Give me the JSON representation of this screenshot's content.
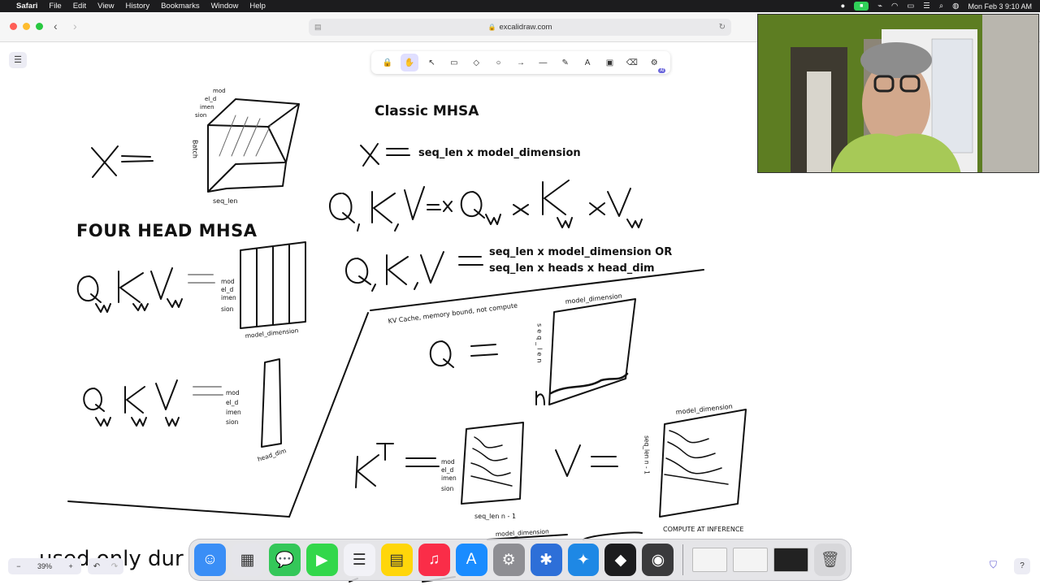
{
  "menubar": {
    "app": "Safari",
    "items": [
      "File",
      "Edit",
      "View",
      "History",
      "Bookmarks",
      "Window",
      "Help"
    ],
    "clock": "Mon Feb 3  9:10 AM"
  },
  "browser": {
    "url": "excalidraw.com"
  },
  "toolbar": {
    "tools": [
      {
        "icon": "lock-icon",
        "glyph": "🔒"
      },
      {
        "icon": "hand-icon",
        "glyph": "✋"
      },
      {
        "icon": "selection-icon",
        "glyph": "↖"
      },
      {
        "icon": "rectangle-icon",
        "glyph": "▭"
      },
      {
        "icon": "diamond-icon",
        "glyph": "◇"
      },
      {
        "icon": "ellipse-icon",
        "glyph": "○"
      },
      {
        "icon": "arrow-icon",
        "glyph": "→"
      },
      {
        "icon": "line-icon",
        "glyph": "—"
      },
      {
        "icon": "pencil-icon",
        "glyph": "✎"
      },
      {
        "icon": "text-icon",
        "glyph": "A"
      },
      {
        "icon": "image-icon",
        "glyph": "▣"
      },
      {
        "icon": "eraser-icon",
        "glyph": "⌫"
      },
      {
        "icon": "ai-tools-icon",
        "glyph": "⚙"
      }
    ],
    "active_index": 1,
    "ai_badge": "AI"
  },
  "drawing": {
    "title_classic": "Classic MHSA",
    "classic_x_shape": "seq_len x model_dimension",
    "qkv_shape_line1": "seq_len x model_dimension OR",
    "qkv_shape_line2": "seq_len x heads x head_dim",
    "title_four_head": "FOUR HEAD MHSA",
    "cube_side_label": "Batch",
    "cube_top_label": [
      "mod",
      "el_d",
      "imen",
      "sion"
    ],
    "cube_bottom_label": "seq_len",
    "model_dim_stack": [
      "mod",
      "el_d",
      "imen",
      "sion"
    ],
    "model_dimension_label": "model_dimension",
    "head_dim_label": "head_dim",
    "kv_cache_note": "KV Cache, memory bound, not compute",
    "seq_len_vertical": "seq_len",
    "seq_len_n1": "seq_len n - 1",
    "compute_note": "COMPUTE AT INFERENCE",
    "bottom_text": "used only dur",
    "q_cache_label": "Q",
    "k_label": "K",
    "v_label": "V",
    "n_label": "n"
  },
  "bottom_controls": {
    "zoom_out": "−",
    "zoom_level": "39%",
    "zoom_in": "+",
    "undo": "↶",
    "redo": "↷",
    "help": "?"
  },
  "dock": {
    "apps": [
      {
        "name": "finder",
        "glyph": "☺",
        "color": "#3a8ef6"
      },
      {
        "name": "launchpad",
        "glyph": "▦",
        "color": "#e5e5ea"
      },
      {
        "name": "messages",
        "glyph": "💬",
        "color": "#34c759"
      },
      {
        "name": "facetime",
        "glyph": "▶",
        "color": "#32d74b"
      },
      {
        "name": "reminders",
        "glyph": "☰",
        "color": "#f2f2f7"
      },
      {
        "name": "notes",
        "glyph": "▤",
        "color": "#ffd60a"
      },
      {
        "name": "music",
        "glyph": "♫",
        "color": "#fa2d48"
      },
      {
        "name": "app-store",
        "glyph": "A",
        "color": "#1a8cff"
      },
      {
        "name": "system-settings",
        "glyph": "⚙",
        "color": "#8e8e93"
      },
      {
        "name": "vs-code",
        "glyph": "✱",
        "color": "#2d6fd8"
      },
      {
        "name": "safari",
        "glyph": "✦",
        "color": "#1e88e5"
      },
      {
        "name": "cube-app",
        "glyph": "◆",
        "color": "#1c1c1e"
      },
      {
        "name": "quicktime",
        "glyph": "◉",
        "color": "#3a3a3c"
      }
    ]
  }
}
